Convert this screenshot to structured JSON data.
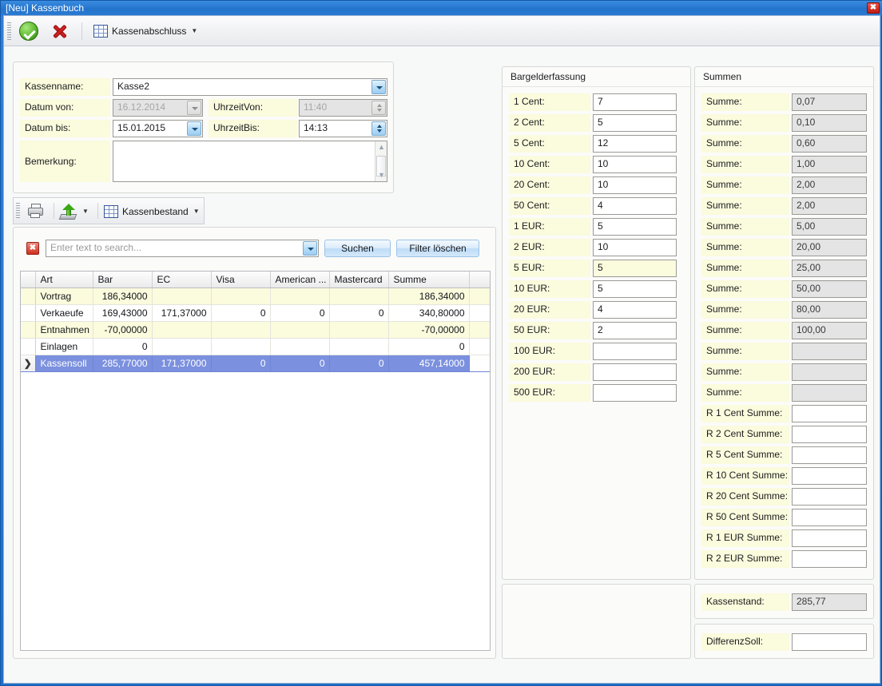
{
  "window": {
    "title": "[Neu] Kassenbuch",
    "close_label": "✖",
    "titlebar_color": "#2474cc"
  },
  "main_toolbar": {
    "ok_icon": "green-check-icon",
    "cancel_icon": "red-x-icon",
    "kassenabschluss_label": "Kassenabschluss",
    "kassenabschluss_caret": "▼"
  },
  "form": {
    "kassenname_label": "Kassenname:",
    "kassenname_value": "Kasse2",
    "datum_von_label": "Datum  von:",
    "datum_von_value": "16.12.2014",
    "uhrzeit_von_label": "UhrzeitVon:",
    "uhrzeit_von_value": "11:40",
    "datum_bis_label": "Datum bis:",
    "datum_bis_value": "15.01.2015",
    "uhrzeit_bis_label": "UhrzeitBis:",
    "uhrzeit_bis_value": "14:13",
    "bemerkung_label": "Bemerkung:",
    "bemerkung_value": ""
  },
  "grid_toolbar": {
    "print_icon": "printer-icon",
    "export_icon": "export-icon",
    "export_caret": "▼",
    "kassenbestand_label": "Kassenbestand",
    "kassenbestand_caret": "▼"
  },
  "search": {
    "clear_icon": "✖",
    "placeholder": "Enter text to search...",
    "value": "",
    "suchen_label": "Suchen",
    "filter_loeschen_label": "Filter löschen"
  },
  "grid": {
    "columns": [
      "Art",
      "Bar",
      "EC",
      "Visa",
      "American ...",
      "Mastercard",
      "Summe"
    ],
    "rows": [
      {
        "cells": [
          "Vortrag",
          "186,34000",
          "",
          "",
          "",
          "",
          "186,34000"
        ],
        "selected": false
      },
      {
        "cells": [
          "Verkaeufe",
          "169,43000",
          "171,37000",
          "0",
          "0",
          "0",
          "340,80000"
        ],
        "selected": false
      },
      {
        "cells": [
          "Entnahmen",
          "-70,00000",
          "",
          "",
          "",
          "",
          "-70,00000"
        ],
        "selected": false
      },
      {
        "cells": [
          "Einlagen",
          "0",
          "",
          "",
          "",
          "",
          "0"
        ],
        "selected": false
      },
      {
        "cells": [
          "Kassensoll",
          "285,77000",
          "171,37000",
          "0",
          "0",
          "0",
          "457,14000"
        ],
        "selected": true
      }
    ],
    "selected_marker": "❯"
  },
  "bargelderfassung": {
    "title": "Bargelderfassung",
    "rows": [
      {
        "label": "1 Cent:",
        "value": "7",
        "focused": false
      },
      {
        "label": "2 Cent:",
        "value": "5",
        "focused": false
      },
      {
        "label": "5 Cent:",
        "value": "12",
        "focused": false
      },
      {
        "label": "10 Cent:",
        "value": "10",
        "focused": false
      },
      {
        "label": "20 Cent:",
        "value": "10",
        "focused": false
      },
      {
        "label": "50 Cent:",
        "value": "4",
        "focused": false
      },
      {
        "label": "1 EUR:",
        "value": "5",
        "focused": false
      },
      {
        "label": "2 EUR:",
        "value": "10",
        "focused": false
      },
      {
        "label": "5 EUR:",
        "value": "5",
        "focused": true
      },
      {
        "label": "10 EUR:",
        "value": "5",
        "focused": false
      },
      {
        "label": "20 EUR:",
        "value": "4",
        "focused": false
      },
      {
        "label": "50 EUR:",
        "value": "2",
        "focused": false
      },
      {
        "label": "100 EUR:",
        "value": "",
        "focused": false
      },
      {
        "label": "200 EUR:",
        "value": "",
        "focused": false
      },
      {
        "label": "500 EUR:",
        "value": "",
        "focused": false
      }
    ]
  },
  "summen": {
    "title": "Summen",
    "rows": [
      {
        "label": "Summe:",
        "value": "0,07",
        "readonly": true
      },
      {
        "label": "Summe:",
        "value": "0,10",
        "readonly": true
      },
      {
        "label": "Summe:",
        "value": "0,60",
        "readonly": true
      },
      {
        "label": "Summe:",
        "value": "1,00",
        "readonly": true
      },
      {
        "label": "Summe:",
        "value": "2,00",
        "readonly": true
      },
      {
        "label": "Summe:",
        "value": "2,00",
        "readonly": true
      },
      {
        "label": "Summe:",
        "value": "5,00",
        "readonly": true
      },
      {
        "label": "Summe:",
        "value": "20,00",
        "readonly": true
      },
      {
        "label": "Summe:",
        "value": "25,00",
        "readonly": true
      },
      {
        "label": "Summe:",
        "value": "50,00",
        "readonly": true
      },
      {
        "label": "Summe:",
        "value": "80,00",
        "readonly": true
      },
      {
        "label": "Summe:",
        "value": "100,00",
        "readonly": true
      },
      {
        "label": "Summe:",
        "value": "",
        "readonly": true
      },
      {
        "label": "Summe:",
        "value": "",
        "readonly": true
      },
      {
        "label": "Summe:",
        "value": "",
        "readonly": true
      },
      {
        "label": "R 1 Cent Summe:",
        "value": "",
        "readonly": false
      },
      {
        "label": "R 2 Cent Summe:",
        "value": "",
        "readonly": false
      },
      {
        "label": "R 5 Cent Summe:",
        "value": "",
        "readonly": false
      },
      {
        "label": "R 10 Cent Summe:",
        "value": "",
        "readonly": false
      },
      {
        "label": "R 20 Cent Summe:",
        "value": "",
        "readonly": false
      },
      {
        "label": "R 50 Cent Summe:",
        "value": "",
        "readonly": false
      },
      {
        "label": "R 1 EUR Summe:",
        "value": "",
        "readonly": false
      },
      {
        "label": "R 2 EUR Summe:",
        "value": "",
        "readonly": false
      }
    ]
  },
  "kassenstand": {
    "label": "Kassenstand:",
    "value": "285,77"
  },
  "differenzsoll": {
    "label": "DifferenzSoll:",
    "value": ""
  }
}
